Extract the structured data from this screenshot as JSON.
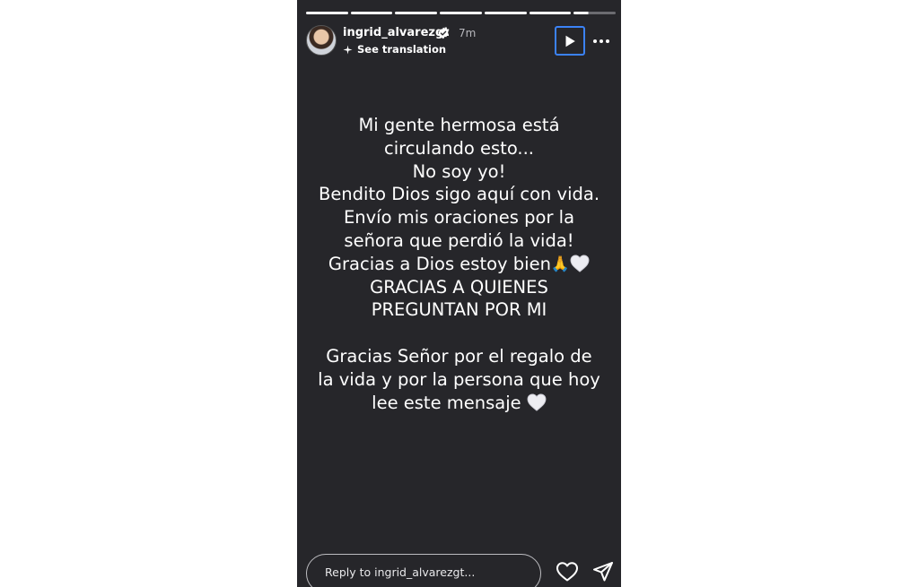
{
  "story": {
    "progress_segments": [
      1,
      1,
      1,
      1,
      1,
      1,
      0.35
    ],
    "author": {
      "username": "ingrid_alvarezgt",
      "time_ago": "7m",
      "avatar": "profile-photo",
      "verified_icon": "verified-badge-icon"
    },
    "translation_label": "See translation",
    "message_lines": [
      "Mi gente hermosa está",
      "circulando esto...",
      "No soy yo!",
      "Bendito Dios sigo aquí con vida.",
      "Envío mis oraciones por la",
      "señora que perdió la vida!",
      "Gracias a Dios estoy bien",
      "GRACIAS A QUIENES",
      "PREGUNTAN POR MI",
      "",
      "Gracias Señor por el regalo de",
      "la vida y por la persona que hoy",
      "lee este mensaje"
    ],
    "emoji": {
      "pray": "🙏"
    },
    "reply_placeholder": "Reply to ingrid_alvarezgt...",
    "icons": [
      "play-icon",
      "more-icon",
      "heart-icon",
      "send-icon",
      "translate-icon",
      "white-heart-emoji"
    ]
  },
  "colors": {
    "story_background": "#26262a",
    "play_button_outline": "#3b82f6",
    "text": "#ffffff"
  }
}
